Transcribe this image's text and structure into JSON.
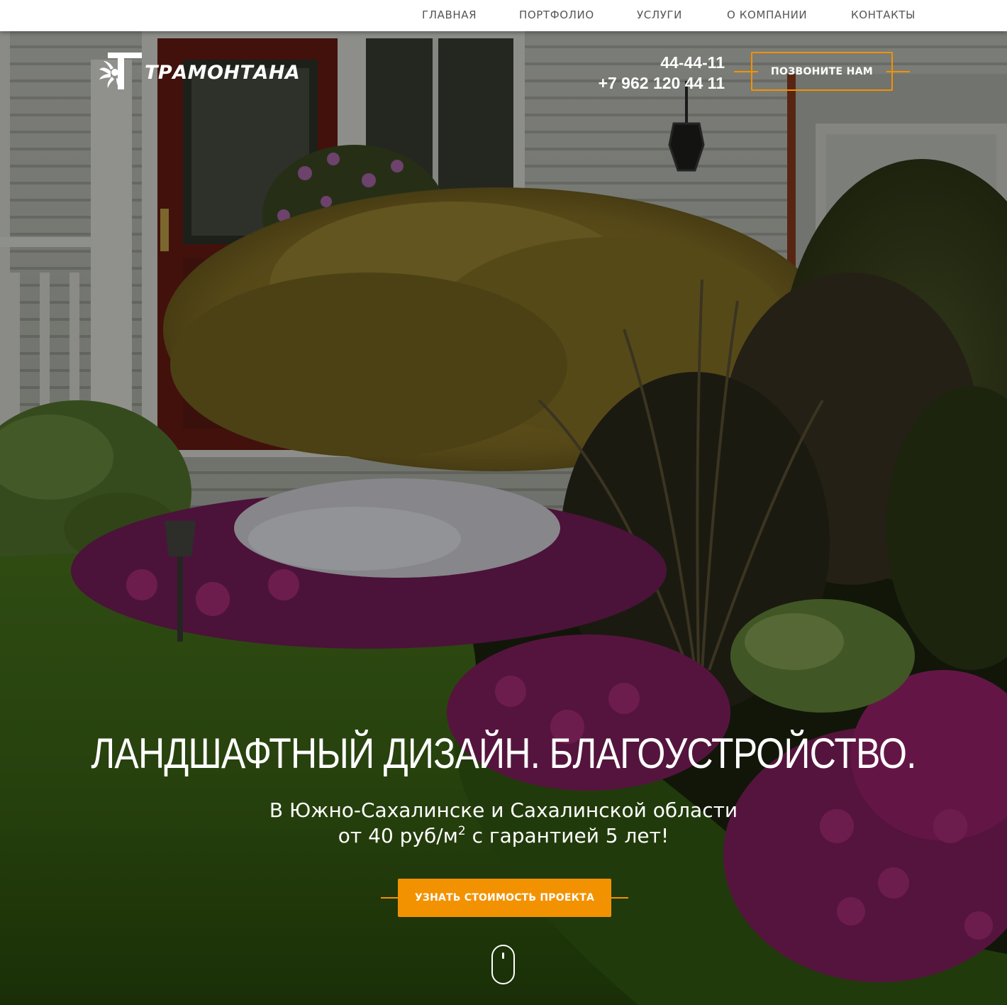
{
  "nav": {
    "items": [
      {
        "label": "ГЛАВНАЯ"
      },
      {
        "label": "ПОРТФОЛИО"
      },
      {
        "label": "УСЛУГИ"
      },
      {
        "label": "О КОМПАНИИ"
      },
      {
        "label": "КОНТАКТЫ"
      }
    ]
  },
  "header": {
    "logo_text": "ТРАМОНТАНА",
    "logo_icon": "sun-swirl-logo-icon",
    "phone_short": "44-44-11",
    "phone_full": "+7 962 120 44 11",
    "call_button": "ПОЗВОНИТЕ НАМ"
  },
  "hero": {
    "title": "ЛАНДШАФТНЫЙ ДИЗАЙН. БЛАГОУСТРОЙСТВО.",
    "subtitle_line1": "В Южно-Сахалинске и Сахалинской области",
    "subtitle_line2_prefix": "от 40 руб/м",
    "subtitle_line2_sup": "2",
    "subtitle_line2_suffix": " с гарантией 5 лет!",
    "cta_button": "УЗНАТЬ СТОИМОСТЬ ПРОЕКТА",
    "scroll_icon": "mouse-scroll-icon",
    "background_image": "garden-house-photo"
  },
  "colors": {
    "accent": "#f39200",
    "nav_bg": "#ffffff",
    "nav_text": "#555555",
    "text_light": "#ffffff"
  }
}
